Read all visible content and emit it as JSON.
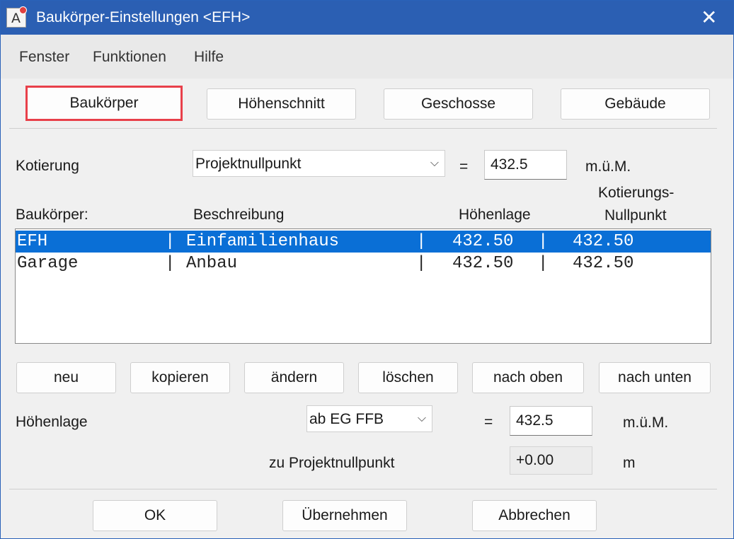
{
  "window": {
    "title": "Baukörper-Einstellungen <EFH>",
    "icon": "app-icon",
    "close_glyph": "✕"
  },
  "menu": [
    "Fenster",
    "Funktionen",
    "Hilfe"
  ],
  "tabs": [
    {
      "label": "Baukörper",
      "active": true
    },
    {
      "label": "Höhenschnitt",
      "active": false
    },
    {
      "label": "Geschosse",
      "active": false
    },
    {
      "label": "Gebäude",
      "active": false
    }
  ],
  "kotierung": {
    "label": "Kotierung",
    "select_value": "Projektnullpunkt",
    "equals": "=",
    "value": "432.5",
    "unit": "m.ü.M."
  },
  "list": {
    "headers": {
      "baukoerper": "Baukörper:",
      "beschreibung": "Beschreibung",
      "hoehenlage": "Höhenlage",
      "kot_line1": "Kotierungs-",
      "kot_line2": "Nullpunkt"
    },
    "rows": [
      {
        "name": "EFH",
        "sep1": "|",
        "desc": "Einfamilienhaus",
        "sep2": "|",
        "height": "432.50",
        "sep3": "|",
        "kot": "432.50",
        "selected": true
      },
      {
        "name": "Garage",
        "sep1": "|",
        "desc": "Anbau",
        "sep2": "|",
        "height": "432.50",
        "sep3": "|",
        "kot": "432.50",
        "selected": false
      }
    ]
  },
  "actions": [
    "neu",
    "kopieren",
    "ändern",
    "löschen",
    "nach oben",
    "nach unten"
  ],
  "hoehenlage": {
    "label": "Höhenlage",
    "select_value": "ab EG FFB",
    "equals": "=",
    "value": "432.5",
    "unit": "m.ü.M.",
    "ref_label": "zu Projektnullpunkt",
    "ref_value": "+0.00",
    "ref_unit": "m"
  },
  "footer": {
    "ok": "OK",
    "apply": "Übernehmen",
    "cancel": "Abbrechen"
  },
  "colors": {
    "titlebar": "#2b5fb3",
    "selection": "#0a6fd6",
    "active_tab_border": "#e8404a"
  },
  "icons": {
    "dropdown": "chevron-down-icon",
    "close": "close-icon"
  }
}
